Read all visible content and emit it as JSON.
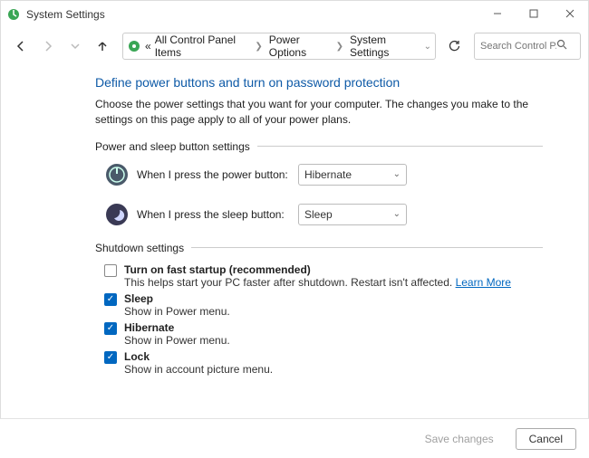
{
  "window": {
    "title": "System Settings"
  },
  "breadcrumbs": {
    "root_prefix": "«",
    "item0": "All Control Panel Items",
    "item1": "Power Options",
    "item2": "System Settings"
  },
  "search": {
    "placeholder": "Search Control P..."
  },
  "page": {
    "heading": "Define power buttons and turn on password protection",
    "description": "Choose the power settings that you want for your computer. The changes you make to the settings on this page apply to all of your power plans."
  },
  "section_buttons": {
    "title": "Power and sleep button settings",
    "power_label": "When I press the power button:",
    "power_value": "Hibernate",
    "sleep_label": "When I press the sleep button:",
    "sleep_value": "Sleep"
  },
  "section_shutdown": {
    "title": "Shutdown settings",
    "items": [
      {
        "checked": false,
        "title": "Turn on fast startup (recommended)",
        "sub": "This helps start your PC faster after shutdown. Restart isn't affected. ",
        "learn_more": "Learn More"
      },
      {
        "checked": true,
        "title": "Sleep",
        "sub": "Show in Power menu."
      },
      {
        "checked": true,
        "title": "Hibernate",
        "sub": "Show in Power menu."
      },
      {
        "checked": true,
        "title": "Lock",
        "sub": "Show in account picture menu."
      }
    ]
  },
  "footer": {
    "save": "Save changes",
    "cancel": "Cancel"
  }
}
